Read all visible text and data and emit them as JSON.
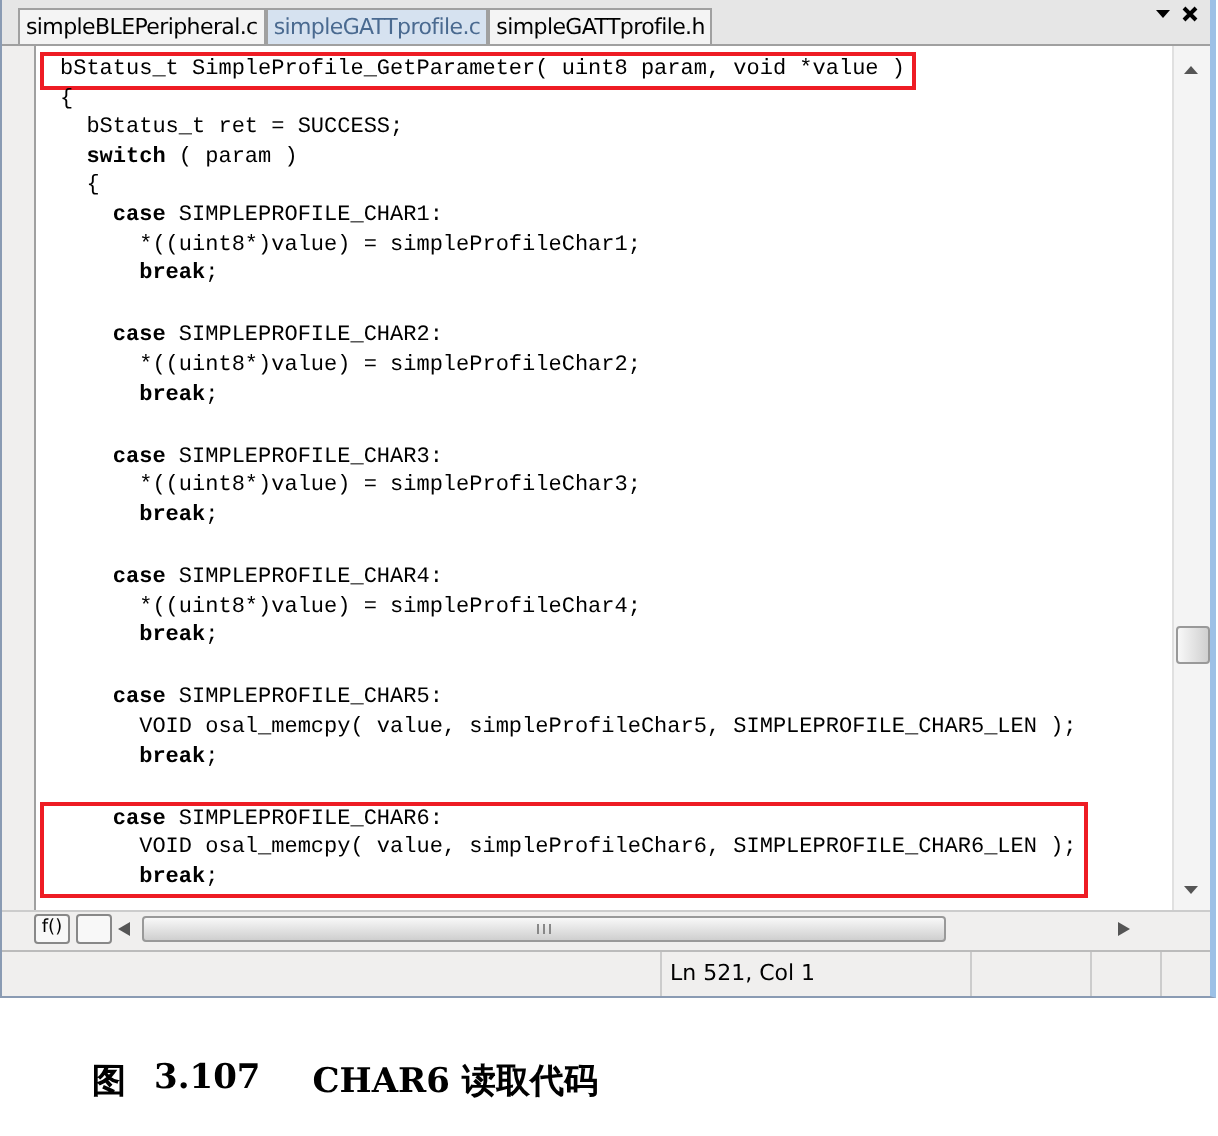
{
  "tabs": [
    {
      "label": "simpleBLEPeripheral.c",
      "selected": false
    },
    {
      "label": "simpleGATTprofile.c",
      "selected": true
    },
    {
      "label": "simpleGATTprofile.h",
      "selected": false
    }
  ],
  "code": {
    "signature": {
      "highlighted": true,
      "text": "bStatus_t SimpleProfile_GetParameter( uint8 param, void *value )"
    },
    "preamble": [
      {
        "text": "{"
      },
      {
        "text": "  bStatus_t ret = SUCCESS;"
      },
      {
        "keyword": "  switch",
        "text": " ( param )"
      },
      {
        "text": "  {"
      }
    ],
    "cases": [
      {
        "highlighted": false,
        "lines": [
          {
            "keyword": "    case",
            "text": " SIMPLEPROFILE_CHAR1:"
          },
          {
            "text": "      *((uint8*)value) = simpleProfileChar1;"
          },
          {
            "keyword": "      break",
            "text": ";"
          }
        ]
      },
      {
        "highlighted": false,
        "lines": [
          {
            "keyword": "    case",
            "text": " SIMPLEPROFILE_CHAR2:"
          },
          {
            "text": "      *((uint8*)value) = simpleProfileChar2;"
          },
          {
            "keyword": "      break",
            "text": ";"
          }
        ]
      },
      {
        "highlighted": false,
        "lines": [
          {
            "keyword": "    case",
            "text": " SIMPLEPROFILE_CHAR3:"
          },
          {
            "text": "      *((uint8*)value) = simpleProfileChar3;"
          },
          {
            "keyword": "      break",
            "text": ";"
          }
        ]
      },
      {
        "highlighted": false,
        "lines": [
          {
            "keyword": "    case",
            "text": " SIMPLEPROFILE_CHAR4:"
          },
          {
            "text": "      *((uint8*)value) = simpleProfileChar4;"
          },
          {
            "keyword": "      break",
            "text": ";"
          }
        ]
      },
      {
        "highlighted": false,
        "lines": [
          {
            "keyword": "    case",
            "text": " SIMPLEPROFILE_CHAR5:"
          },
          {
            "text": "      VOID osal_memcpy( value, simpleProfileChar5, SIMPLEPROFILE_CHAR5_LEN );"
          },
          {
            "keyword": "      break",
            "text": ";"
          }
        ]
      },
      {
        "highlighted": true,
        "lines": [
          {
            "keyword": "    case",
            "text": " SIMPLEPROFILE_CHAR6:"
          },
          {
            "text": "      VOID osal_memcpy( value, simpleProfileChar6, SIMPLEPROFILE_CHAR6_LEN );"
          },
          {
            "keyword": "      break",
            "text": ";"
          }
        ]
      }
    ]
  },
  "function_button": "f()",
  "status_bar": {
    "position": "Ln 521, Col 1"
  },
  "caption": {
    "label": "图",
    "number": "3.107",
    "title": "CHAR6 读取代码"
  }
}
